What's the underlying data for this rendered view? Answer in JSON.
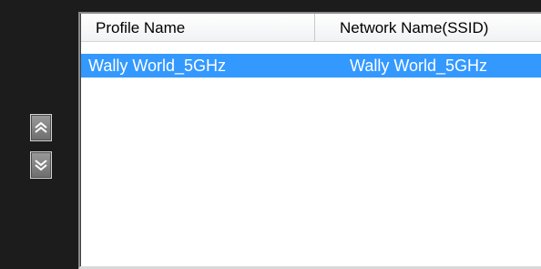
{
  "profile_list": {
    "columns": {
      "profile_name": "Profile Name",
      "network_name": "Network Name(SSID)"
    },
    "rows": [
      {
        "profile_name": "Wally World_5GHz",
        "network_name": "Wally World_5GHz",
        "selected": true
      }
    ]
  },
  "controls": {
    "move_up_icon": "double-chevron-up-icon",
    "move_down_icon": "double-chevron-down-icon"
  },
  "colors": {
    "selection": "#3399ff",
    "panel_background": "#1c1c1c"
  }
}
